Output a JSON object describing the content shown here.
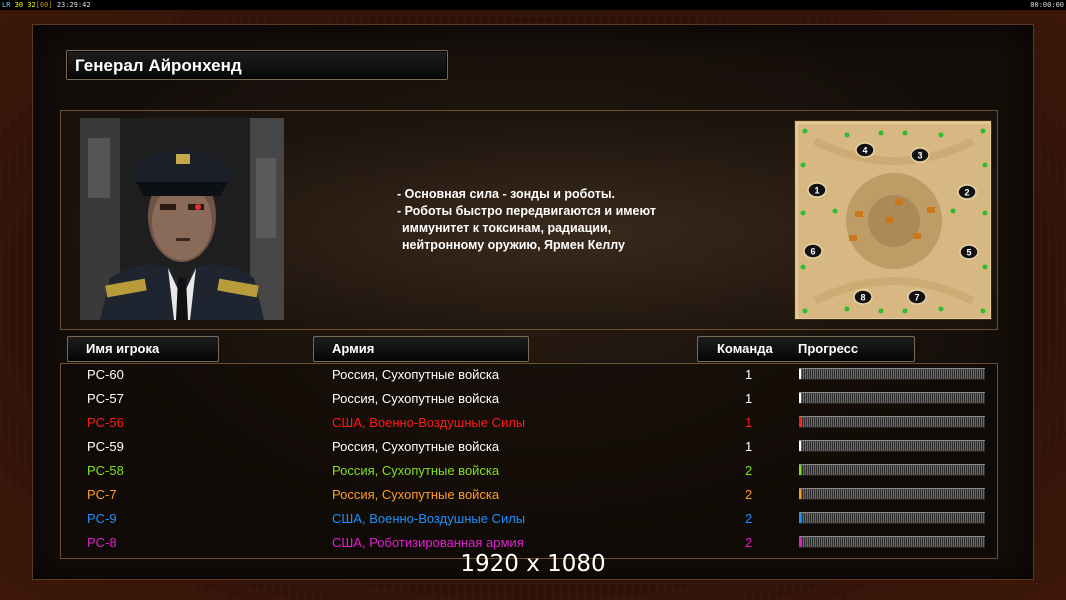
{
  "topbar": {
    "lr_label": "LR",
    "fps": "30 32",
    "fps_max": "[60]",
    "clock": "23:29:42",
    "timer": "00:00:00"
  },
  "general": {
    "title": "Генерал Айронхенд",
    "description": [
      "- Основная сила - зонды и роботы.",
      "- Роботы быстро передвигаются и имеют",
      "иммунитет к токсинам, радиации,",
      "нейтронному оружию, Ярмен Келлу"
    ]
  },
  "minimap": {
    "start_positions": [
      "1",
      "2",
      "3",
      "4",
      "5",
      "6",
      "7",
      "8"
    ]
  },
  "table": {
    "headers": {
      "name": "Имя игрока",
      "army": "Армия",
      "team": "Команда",
      "progress": "Прогресс"
    },
    "rows": [
      {
        "name": "PC-60",
        "army": "Россия, Сухопутные войска",
        "team": "1",
        "color": "#ffffff",
        "progress": 0.01
      },
      {
        "name": "PC-57",
        "army": "Россия, Сухопутные войска",
        "team": "1",
        "color": "#ffffff",
        "progress": 0.0
      },
      {
        "name": "PC-56",
        "army": "США, Военно-Воздушные Силы",
        "team": "1",
        "color": "#ff1a1a",
        "progress": 0.01
      },
      {
        "name": "PC-59",
        "army": "Россия, Сухопутные войска",
        "team": "1",
        "color": "#ffffff",
        "progress": 0.0
      },
      {
        "name": "PC-58",
        "army": "Россия, Сухопутные войска",
        "team": "2",
        "color": "#80e020",
        "progress": 0.0
      },
      {
        "name": "PC-7",
        "army": "Россия, Сухопутные войска",
        "team": "2",
        "color": "#ff9a2a",
        "progress": 0.01
      },
      {
        "name": "PC-9",
        "army": "США, Военно-Воздушные Силы",
        "team": "2",
        "color": "#1e90ff",
        "progress": 0.0
      },
      {
        "name": "PC-8",
        "army": "США, Роботизированная армия",
        "team": "2",
        "color": "#e020d0",
        "progress": 0.0
      }
    ]
  },
  "caption": "1920 x 1080"
}
